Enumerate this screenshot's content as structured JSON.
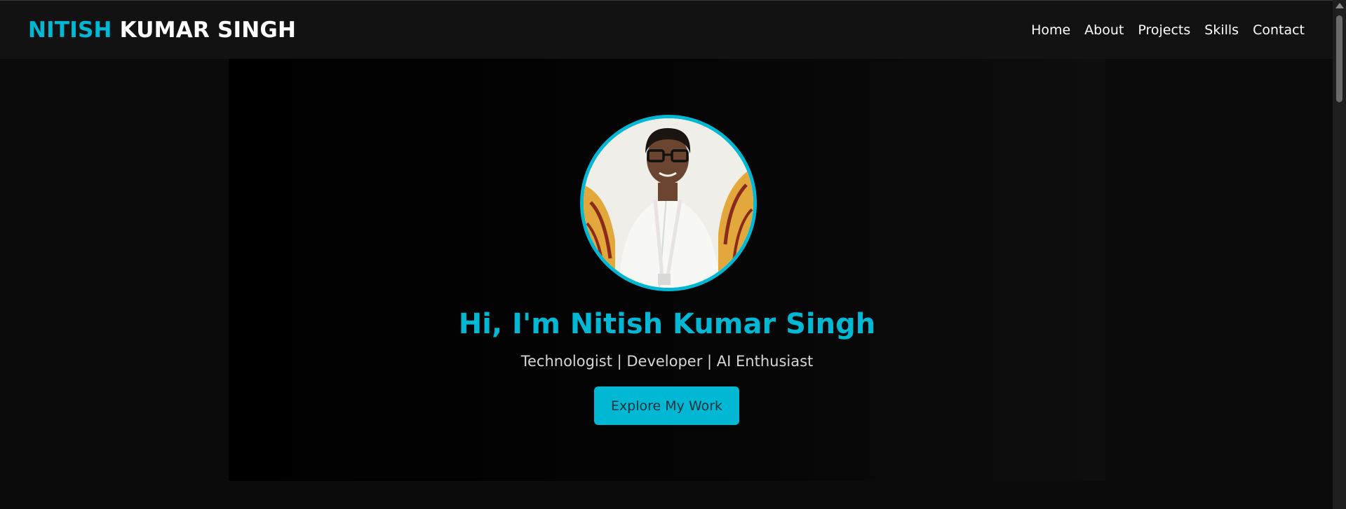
{
  "header": {
    "brand_first": "NITISH",
    "brand_rest": " KUMAR SINGH",
    "nav": [
      {
        "label": "Home",
        "icon": null
      },
      {
        "label": "About",
        "icon": null
      },
      {
        "label": "Projects",
        "icon": null
      },
      {
        "label": "Skills",
        "icon": null
      },
      {
        "label": "Contact",
        "icon": null
      }
    ]
  },
  "hero": {
    "avatar_icon": "profile-photo",
    "title": "Hi, I'm Nitish Kumar Singh",
    "subtitle": "Technologist | Developer | AI Enthusiast",
    "cta_label": "Explore My Work"
  },
  "colors": {
    "accent": "#00b7d4",
    "background": "#0b0b0b",
    "navbar": "#121212",
    "text": "#ffffff"
  }
}
